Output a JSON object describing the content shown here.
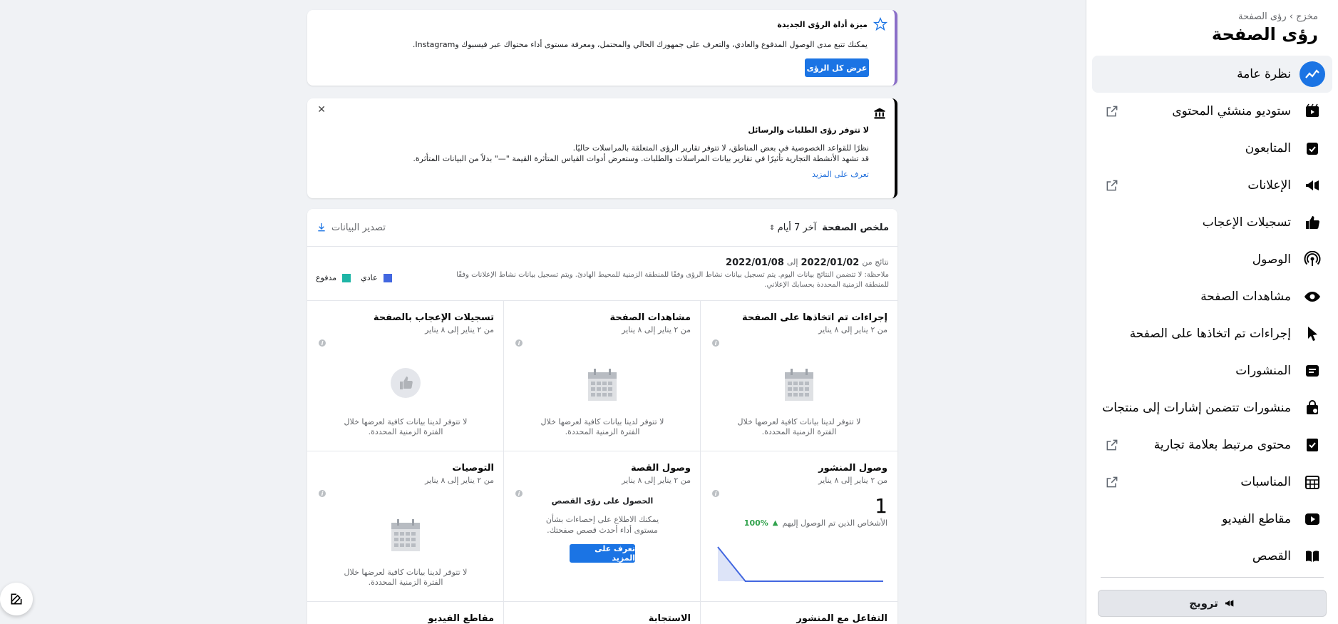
{
  "sidebar": {
    "breadcrumb": "مخزج › رؤى الصفحة",
    "title": "رؤى الصفحة",
    "items": [
      {
        "label": "نظرة عامة",
        "icon": "trend-line-icon",
        "active": true
      },
      {
        "label": "ستوديو منشئي المحتوى",
        "icon": "video-studio-icon",
        "external": true
      },
      {
        "label": "المتابعون",
        "icon": "followers-check-icon"
      },
      {
        "label": "الإعلانات",
        "icon": "megaphone-icon",
        "external": true
      },
      {
        "label": "تسجيلات الإعجاب",
        "icon": "thumbs-up-icon"
      },
      {
        "label": "الوصول",
        "icon": "reach-broadcast-icon"
      },
      {
        "label": "مشاهدات الصفحة",
        "icon": "eye-icon"
      },
      {
        "label": "إجراءات تم اتخاذها على الصفحة",
        "icon": "cursor-icon"
      },
      {
        "label": "المنشورات",
        "icon": "posts-icon"
      },
      {
        "label": "منشورات تتضمن إشارات إلى منتجات",
        "icon": "shopping-bag-icon"
      },
      {
        "label": "محتوى مرتبط بعلامة تجارية",
        "icon": "branded-content-icon",
        "external": true
      },
      {
        "label": "المناسبات",
        "icon": "calendar-grid-icon",
        "external": true
      },
      {
        "label": "مقاطع الفيديو",
        "icon": "video-play-icon"
      },
      {
        "label": "القصص",
        "icon": "book-icon"
      }
    ],
    "promote_label": "ترويج"
  },
  "banner1": {
    "title": "ميزة أداة الرؤى الجديدة",
    "text": "يمكنك تتبع مدى الوصول المدفوع والعادي، والتعرف على جمهورك الحالي والمحتمل، ومعرفة مستوى أداء محتواك عبر فيسبوك وInstagram.",
    "button": "عرض كل الرؤى"
  },
  "banner2": {
    "title": "لا تتوفر رؤى الطلبات والرسائل",
    "line1": "نظرًا للقواعد الخصوصية في بعض المناطق، لا تتوفر تقارير الرؤى المتعلقة بالمراسلات حاليًا.",
    "line2": "قد تشهد الأنشطة التجارية تأثيرًا في تقارير بيانات المراسلات والطلبات. وستعرض أدوات القياس المتأثرة القيمة \"—\" بدلاً من البيانات المتأثرة.",
    "link": "تعرف على المزيد"
  },
  "summary": {
    "title": "ملخص الصفحة",
    "range": "آخر 7 أيام",
    "export": "تصدير البيانات",
    "results_prefix": "نتائج من",
    "date_from": "2022/01/02",
    "date_to_prefix": "إلى",
    "date_to": "2022/01/08",
    "note": "ملاحظة: لا تتضمن النتائج بيانات اليوم. يتم تسجيل بيانات نشاط الرؤى وفقًا للمنطقة الزمنية للمحيط الهادئ. ويتم تسجيل بيانات نشاط الإعلانات وفقًا للمنطقة الزمنية المحددة بحسابك الإعلاني.",
    "legend_organic": "عادي",
    "legend_paid": "مدفوع",
    "colors": {
      "organic": "#4267e0",
      "paid": "#1eb5a6"
    }
  },
  "metrics": [
    {
      "title": "إجراءات تم اتخاذها على الصفحة",
      "sub": "من ٢ يناير إلى ٨ يناير",
      "empty": "لا تتوفر لدينا بيانات كافية لعرضها خلال الفترة الزمنية المحددة.",
      "icon": "calendar-icon"
    },
    {
      "title": "مشاهدات الصفحة",
      "sub": "من ٢ يناير إلى ٨ يناير",
      "empty": "لا تتوفر لدينا بيانات كافية لعرضها خلال الفترة الزمنية المحددة.",
      "icon": "calendar-icon"
    },
    {
      "title": "تسجيلات الإعجاب بالصفحة",
      "sub": "من ٢ يناير إلى ٨ يناير",
      "empty": "لا تتوفر لدينا بيانات كافية لعرضها خلال الفترة الزمنية المحددة.",
      "icon": "thumbs-up-icon"
    },
    {
      "title": "وصول المنشور",
      "sub": "من ٢ يناير إلى ٨ يناير",
      "value": "1",
      "caption": "الأشخاص الذين تم الوصول إليهم",
      "change": "100%"
    },
    {
      "title": "وصول القصة",
      "sub": "من ٢ يناير إلى ٨ يناير",
      "promo_title": "الحصول على رؤى القصص",
      "promo_text": "يمكنك الاطلاع على إحصاءات بشأن مستوى أداء أحدث قصص صفحتك.",
      "button": "تعرف على المزيد"
    },
    {
      "title": "التوصيات",
      "sub": "من ٢ يناير إلى ٨ يناير",
      "empty": "لا تتوفر لدينا بيانات كافية لعرضها خلال الفترة الزمنية المحددة.",
      "icon": "calendar-icon"
    },
    {
      "title": "التفاعل مع المنشور"
    },
    {
      "title": "الاستجابة"
    },
    {
      "title": "مقاطع الفيديو"
    }
  ],
  "chart_data": {
    "type": "area",
    "x": [
      1,
      2,
      3,
      4,
      5,
      6,
      7
    ],
    "series": [
      {
        "values": [
          1,
          0,
          0,
          0,
          0,
          0,
          0
        ]
      }
    ],
    "ylim": [
      0,
      1
    ],
    "grid": false
  }
}
